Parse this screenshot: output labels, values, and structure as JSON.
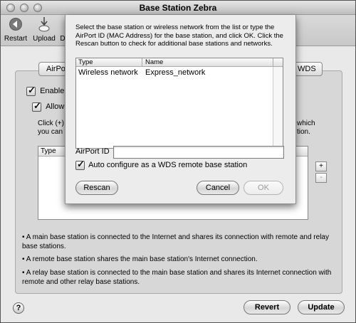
{
  "window": {
    "title": "Base Station Zebra"
  },
  "toolbar": {
    "items": [
      {
        "label": "Restart",
        "icon": "restart-icon"
      },
      {
        "label": "Upload",
        "icon": "upload-icon"
      },
      {
        "label": "D",
        "icon": "default-icon"
      }
    ]
  },
  "tabs": {
    "left_fragment": "AirPo",
    "right_fragment": "WDS"
  },
  "background": {
    "enable_fragment": "Enable t",
    "allow_fragment": "Allow",
    "click_fragment": "Click (+)",
    "you_can_fragment": "you can",
    "which_fragment": "which",
    "tion_fragment": "tion.",
    "table_header_type": "Type",
    "plus_label": "+",
    "minus_label": "-",
    "info_1": "• A main base station is connected to the Internet and shares its connection with remote and relay base stations.",
    "info_2": "• A remote base station shares the main base station's Internet connection.",
    "info_3": "• A relay base station is connected to the main base station and shares its Internet connection with remote and other relay base stations.",
    "help_label": "?",
    "revert_label": "Revert",
    "update_label": "Update"
  },
  "sheet": {
    "message": "Select the base station or wireless network from the list or type the AirPort ID (MAC Address) for the base station, and click OK. Click the Rescan button to check for additional base stations and networks.",
    "list_headers": {
      "type": "Type",
      "name": "Name"
    },
    "rows": [
      {
        "type": "Wireless network",
        "name": "Express_network"
      }
    ],
    "airport_id_label": "AirPort ID",
    "airport_id_value": "",
    "auto_config_label": "Auto configure as a WDS remote base station",
    "rescan_label": "Rescan",
    "cancel_label": "Cancel",
    "ok_label": "OK"
  }
}
